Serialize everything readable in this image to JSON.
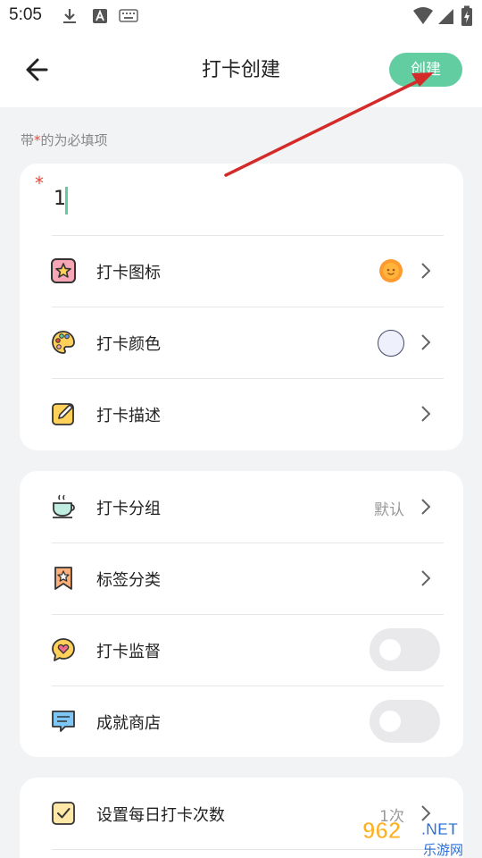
{
  "status_bar": {
    "time": "5:05",
    "icons": [
      "download-icon",
      "keyboard-a-icon",
      "keyboard-icon",
      "wifi-icon",
      "signal-icon",
      "battery-charging-icon"
    ]
  },
  "header": {
    "back_icon": "arrow-left-icon",
    "title": "打卡创建",
    "create_label": "创建"
  },
  "hint": {
    "prefix": "带",
    "star": "*",
    "suffix": "的为必填项"
  },
  "card1": {
    "required_mark": "*",
    "name_value": "1",
    "rows": [
      {
        "label": "打卡图标",
        "icon": "star-square-icon",
        "trailing": "sun-emoji-icon"
      },
      {
        "label": "打卡颜色",
        "icon": "palette-icon",
        "trailing": "color-circle",
        "color": "#eef0fb"
      },
      {
        "label": "打卡描述",
        "icon": "pencil-note-icon"
      }
    ]
  },
  "card2": {
    "rows": [
      {
        "label": "打卡分组",
        "icon": "tea-cup-icon",
        "value": "默认"
      },
      {
        "label": "标签分类",
        "icon": "ribbon-badge-icon"
      },
      {
        "label": "打卡监督",
        "icon": "heart-chat-icon",
        "toggle": false
      },
      {
        "label": "成就商店",
        "icon": "chat-bubble-icon",
        "toggle": false
      }
    ]
  },
  "card3": {
    "rows": [
      {
        "label": "设置每日打卡次数",
        "icon": "checkbox-icon",
        "value": "1次"
      }
    ]
  },
  "colors": {
    "accent": "#63cda2",
    "required": "#e64a3b",
    "annotation_arrow": "#d42a2a"
  },
  "watermark": {
    "logo_text": "962",
    "domain_text": ".NET",
    "site_text": "乐游网"
  }
}
